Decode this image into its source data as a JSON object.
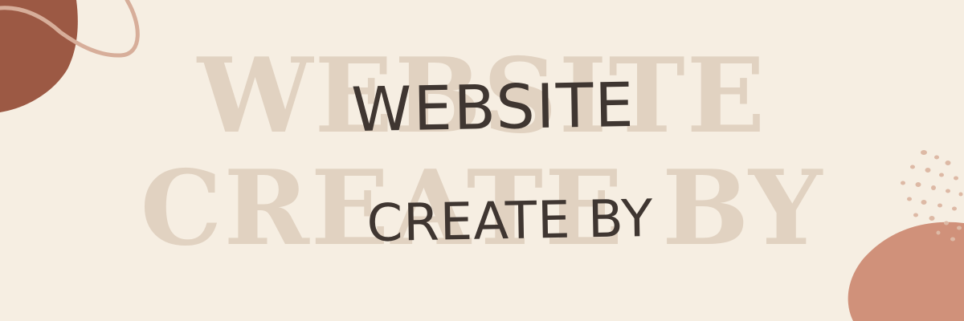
{
  "banner": {
    "background_text": {
      "line1": "WEBSITE",
      "line2": "CREATE BY"
    },
    "foreground_text": {
      "line1": "WEBSITE",
      "line2": "CREATE BY"
    }
  },
  "colors": {
    "background": "#F6EEE2",
    "watermark_text": "#E1D2C1",
    "foreground_text": "#3F3631",
    "blob_dark": "#9C5944",
    "blob_light": "#D0917A",
    "squiggle": "#D7AE9A",
    "dots": "#DDB9A5"
  },
  "icons": {
    "top_left": "dark-blob-icon",
    "top_left_line": "squiggle-line-icon",
    "bottom_right": "peach-blob-icon",
    "dots": "speckle-dots-icon"
  }
}
